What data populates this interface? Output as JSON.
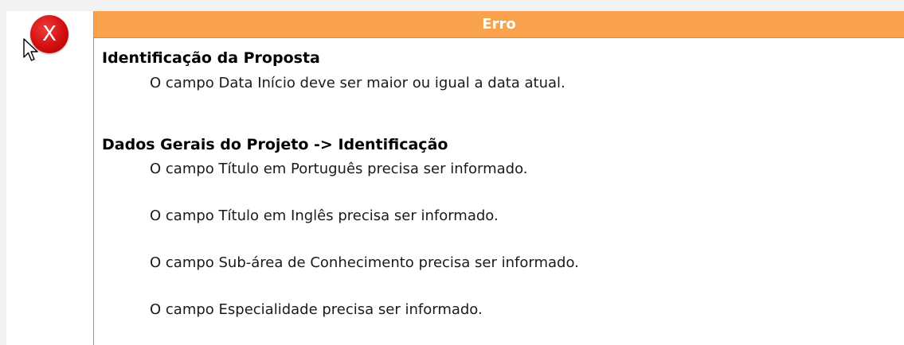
{
  "dialog": {
    "title": "Erro",
    "icon": "error-x-icon",
    "icon_glyph": "X",
    "header_color": "#f9a24d",
    "icon_color": "#d10f0f"
  },
  "sections": [
    {
      "title": "Identificação da Proposta",
      "messages": [
        "O campo Data Início deve ser maior ou igual a data atual."
      ]
    },
    {
      "title": "Dados Gerais do Projeto -> Identificação",
      "messages": [
        "O campo Título em Português precisa ser informado.",
        "O campo Título em Inglês precisa ser informado.",
        "O campo Sub-área de Conhecimento precisa ser informado.",
        "O campo Especialidade precisa ser informado."
      ]
    }
  ]
}
